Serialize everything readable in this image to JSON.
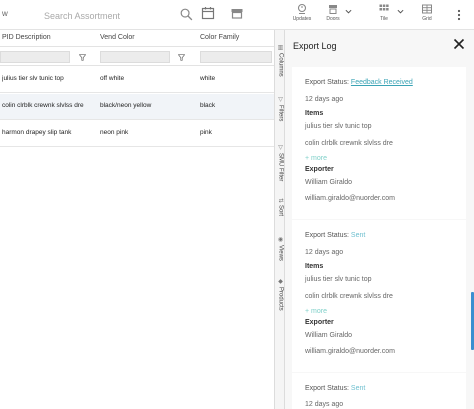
{
  "toolbar": {
    "left_text": "w",
    "search_placeholder": "Search Assortment",
    "updates_label": "Updates",
    "doors_label": "Doors",
    "tile_label": "Tile",
    "grid_label": "Grid"
  },
  "grid": {
    "columns": [
      "PID Description",
      "Vend Color",
      "Color Family"
    ],
    "rows": [
      [
        "julius tier slv tunic top",
        "off white",
        "white"
      ],
      [
        "colin clrblk crewnk slvlss dre",
        "black/neon yellow",
        "black"
      ],
      [
        "harmon drapey slip tank",
        "neon pink",
        "pink"
      ]
    ]
  },
  "sidetabs": [
    "Columns",
    "Filters",
    "SMU Filter",
    "Sort",
    "Views",
    "Products"
  ],
  "panel": {
    "title": "Export Log",
    "entries": [
      {
        "status_label": "Export Status:",
        "status_value": "Feedback Received",
        "time": "12 days ago",
        "items_label": "Items",
        "items": [
          "julius tier slv tunic top",
          "colin clrblk crewnk slvlss dre"
        ],
        "more": "+ more",
        "exporter_label": "Exporter",
        "exporter_name": "William Giraldo",
        "exporter_email": "william.giraldo@nuorder.com"
      },
      {
        "status_label": "Export Status:",
        "status_value": "Sent",
        "time": "12 days ago",
        "items_label": "Items",
        "items": [
          "julius tier slv tunic top",
          "colin clrblk crewnk slvlss dre"
        ],
        "more": "+ more",
        "exporter_label": "Exporter",
        "exporter_name": "William Giraldo",
        "exporter_email": "william.giraldo@nuorder.com"
      },
      {
        "status_label": "Export Status:",
        "status_value": "Sent",
        "time": "12 days ago"
      }
    ]
  },
  "colors": {
    "accent_link": "#3aa3b5",
    "sent": "#6dbfcf",
    "scrollbar": "#3b8fd0",
    "selected_row": "#f1f4f8"
  }
}
